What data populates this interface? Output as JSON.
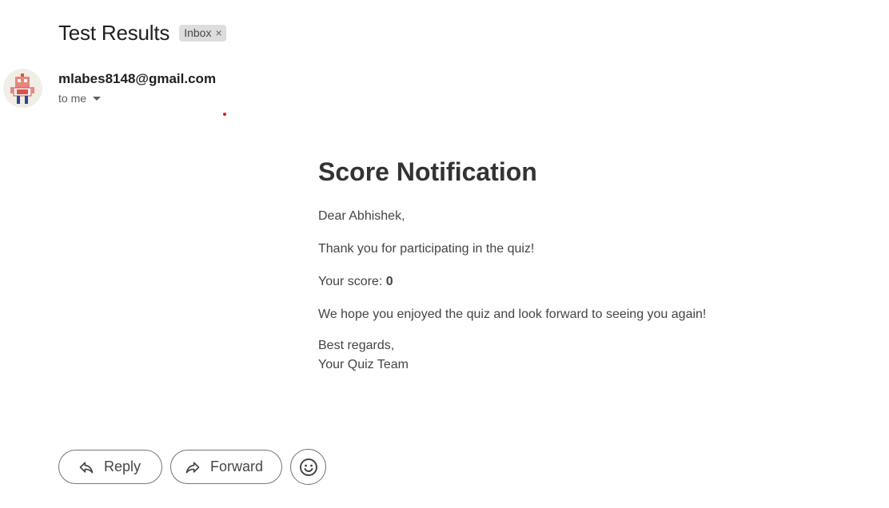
{
  "email": {
    "subject": "Test Results",
    "label": "Inbox",
    "label_remove": "×",
    "sender": "mlabes8148@gmail.com",
    "recipient": "to me"
  },
  "content": {
    "heading": "Score Notification",
    "greeting": "Dear Abhishek,",
    "thanks": "Thank you for participating in the quiz!",
    "score_label": "Your score:",
    "score_value": "0",
    "hope": "We hope you enjoyed the quiz and look forward to seeing you again!",
    "closing_line1": "Best regards,",
    "closing_line2": "Your Quiz Team"
  },
  "actions": {
    "reply_label": "Reply",
    "forward_label": "Forward"
  },
  "icons": {
    "reply": "reply-icon",
    "forward": "forward-icon",
    "emoji": "emoji-reaction-icon",
    "caret": "caret-down-icon",
    "avatar": "robot-avatar-icon"
  },
  "colors": {
    "label_chip_bg": "#dddddd",
    "button_border": "#747775",
    "body_text": "#444444"
  }
}
